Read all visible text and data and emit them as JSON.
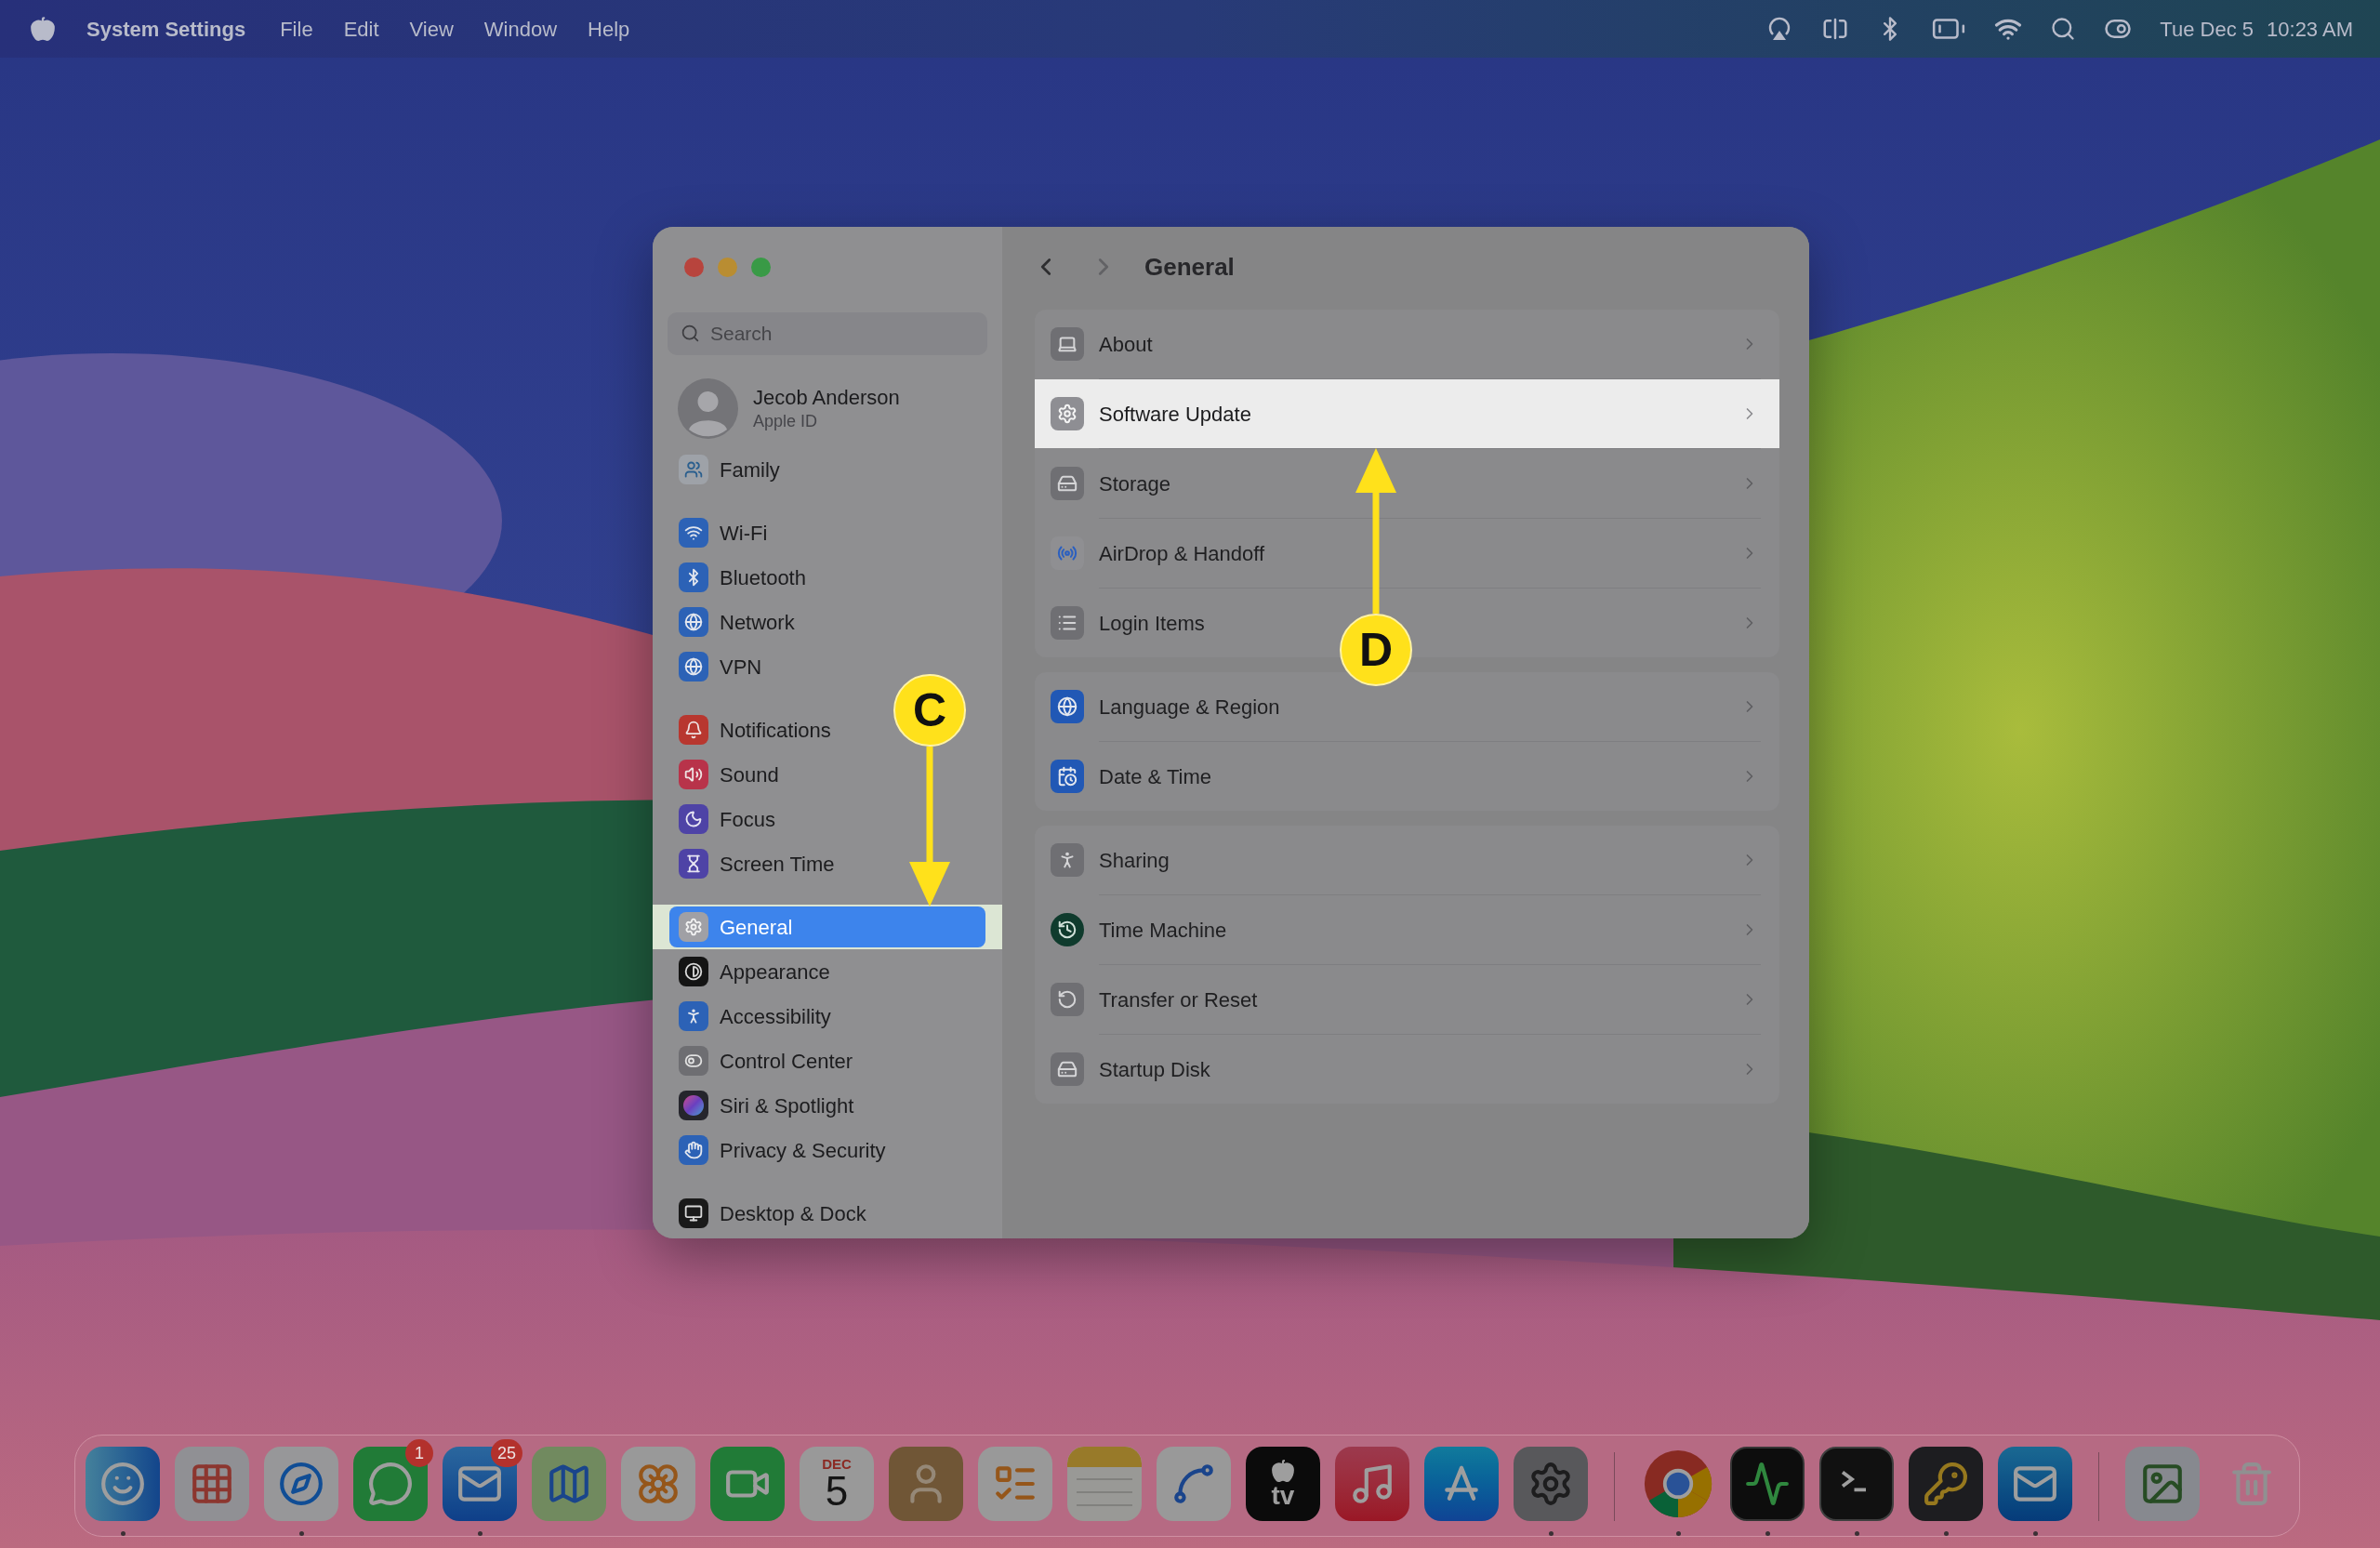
{
  "menu_bar": {
    "app_name": "System Settings",
    "menus": [
      "File",
      "Edit",
      "View",
      "Window",
      "Help"
    ],
    "date": "Tue Dec 5",
    "time": "10:23 AM"
  },
  "window": {
    "title": "General",
    "nav": {
      "back_enabled": true,
      "forward_enabled": false
    },
    "search": {
      "placeholder": "Search"
    },
    "account": {
      "name": "Jecob Anderson",
      "subtitle": "Apple ID"
    },
    "sidebar": {
      "groups": [
        {
          "items": [
            {
              "label": "Family",
              "selected": false
            }
          ]
        },
        {
          "items": [
            {
              "label": "Wi-Fi",
              "selected": false
            },
            {
              "label": "Bluetooth",
              "selected": false
            },
            {
              "label": "Network",
              "selected": false
            },
            {
              "label": "VPN",
              "selected": false
            }
          ]
        },
        {
          "items": [
            {
              "label": "Notifications",
              "selected": false
            },
            {
              "label": "Sound",
              "selected": false
            },
            {
              "label": "Focus",
              "selected": false
            },
            {
              "label": "Screen Time",
              "selected": false
            }
          ]
        },
        {
          "items": [
            {
              "label": "General",
              "selected": true
            },
            {
              "label": "Appearance",
              "selected": false
            },
            {
              "label": "Accessibility",
              "selected": false
            },
            {
              "label": "Control Center",
              "selected": false
            },
            {
              "label": "Siri & Spotlight",
              "selected": false
            },
            {
              "label": "Privacy & Security",
              "selected": false
            }
          ]
        },
        {
          "items": [
            {
              "label": "Desktop & Dock",
              "selected": false
            }
          ]
        }
      ]
    },
    "groups": [
      {
        "rows": [
          {
            "label": "About",
            "highlighted": false
          },
          {
            "label": "Software Update",
            "highlighted": true
          },
          {
            "label": "Storage",
            "highlighted": false
          },
          {
            "label": "AirDrop & Handoff",
            "highlighted": false
          },
          {
            "label": "Login Items",
            "highlighted": false
          }
        ]
      },
      {
        "rows": [
          {
            "label": "Language & Region",
            "highlighted": false
          },
          {
            "label": "Date & Time",
            "highlighted": false
          }
        ]
      },
      {
        "rows": [
          {
            "label": "Sharing",
            "highlighted": false
          },
          {
            "label": "Time Machine",
            "highlighted": false
          },
          {
            "label": "Transfer or Reset",
            "highlighted": false
          },
          {
            "label": "Startup Disk",
            "highlighted": false
          }
        ]
      }
    ]
  },
  "annotations": [
    {
      "label": "C"
    },
    {
      "label": "D"
    }
  ],
  "dock": {
    "groups": [
      {
        "apps": [
          {
            "running": true
          },
          {
            "running": false
          },
          {
            "running": true
          },
          {
            "running": false,
            "badge": "1"
          },
          {
            "running": true,
            "badge": "25"
          },
          {
            "running": false
          },
          {
            "running": false
          },
          {
            "running": false
          },
          {
            "running": false,
            "month": "DEC",
            "day": "5"
          },
          {
            "running": false
          },
          {
            "running": false
          },
          {
            "running": false
          },
          {
            "running": false
          },
          {
            "running": false,
            "label": "tv"
          },
          {
            "running": false
          },
          {
            "running": false
          },
          {
            "running": true
          }
        ]
      },
      {
        "apps": [
          {
            "running": true
          },
          {
            "running": true
          },
          {
            "running": true
          },
          {
            "running": true
          },
          {
            "running": true
          }
        ]
      },
      {
        "apps": [
          {
            "running": false
          },
          {
            "running": false
          }
        ]
      }
    ]
  }
}
